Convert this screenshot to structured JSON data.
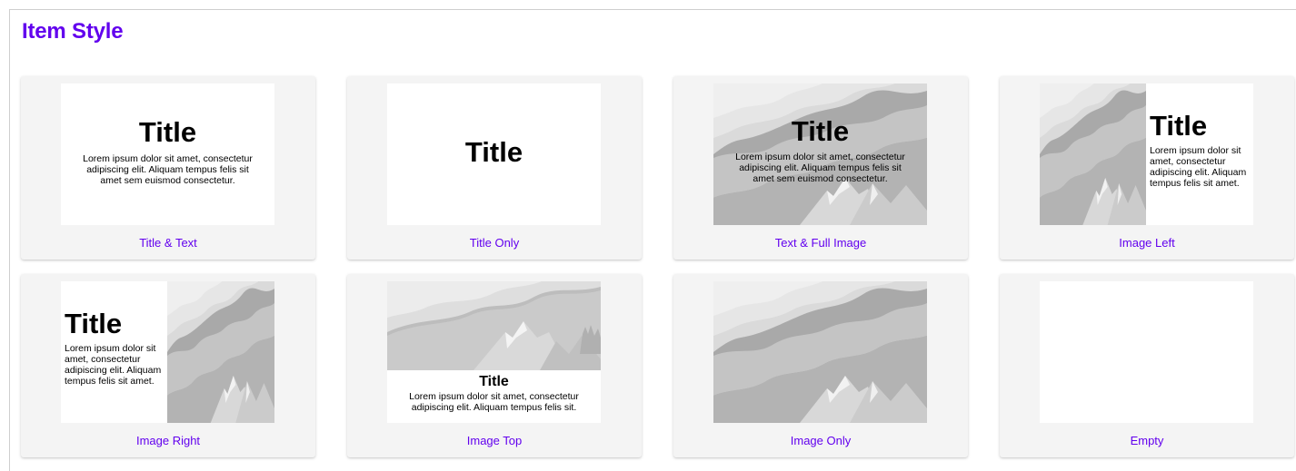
{
  "section": {
    "title": "Item Style"
  },
  "preview_text": {
    "title": "Title",
    "body_long": "Lorem ipsum dolor sit amet, consectetur adipiscing elit. Aliquam tempus felis sit amet sem euismod consectetur.",
    "body_short": "Lorem ipsum dolor sit amet, consectetur adipiscing elit. Aliquam tempus felis sit amet.",
    "body_top": "Lorem ipsum dolor sit amet, consectetur adipiscing elit. Aliquam tempus felis sit."
  },
  "items": [
    {
      "label": "Title & Text"
    },
    {
      "label": "Title Only"
    },
    {
      "label": "Text & Full Image"
    },
    {
      "label": "Image Left"
    },
    {
      "label": "Image Right"
    },
    {
      "label": "Image Top"
    },
    {
      "label": "Image Only"
    },
    {
      "label": "Empty"
    }
  ],
  "colors": {
    "accent": "#6200ee",
    "card_background": "#f4f4f4",
    "placeholder_image": "#b9b9b9"
  }
}
